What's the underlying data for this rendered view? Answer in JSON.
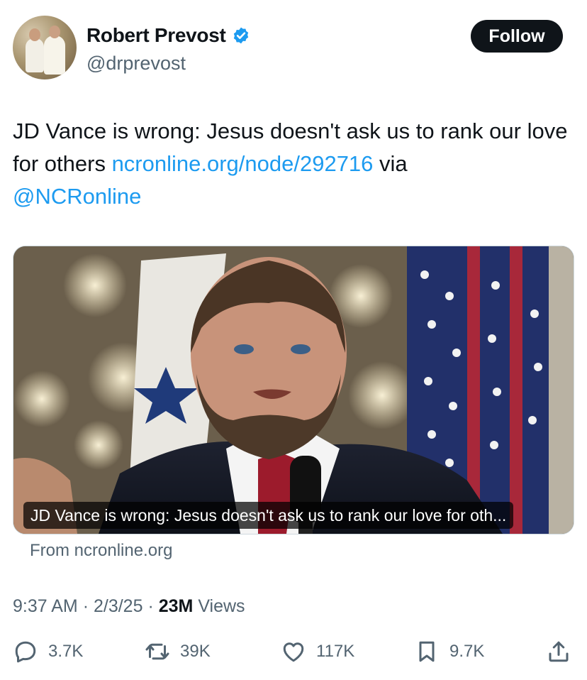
{
  "author": {
    "name": "Robert Prevost",
    "handle": "@drprevost",
    "verified": true
  },
  "follow_label": "Follow",
  "tweet": {
    "text_part1": "JD Vance is wrong: Jesus doesn't ask us to rank our love for others ",
    "link_text": "ncronline.org/node/292716",
    "text_part2": " via",
    "mention": "@NCRonline"
  },
  "card": {
    "caption": "JD Vance is wrong: Jesus doesn't ask us to rank our love for oth...",
    "source": "From ncronline.org"
  },
  "meta": {
    "time": "9:37 AM",
    "date": "2/3/25",
    "views_count": "23M",
    "views_label": "Views"
  },
  "actions": {
    "replies": "3.7K",
    "reposts": "39K",
    "likes": "117K",
    "bookmarks": "9.7K"
  },
  "colors": {
    "accent": "#1d9bf0",
    "text": "#0f1419",
    "secondary": "#536471"
  }
}
